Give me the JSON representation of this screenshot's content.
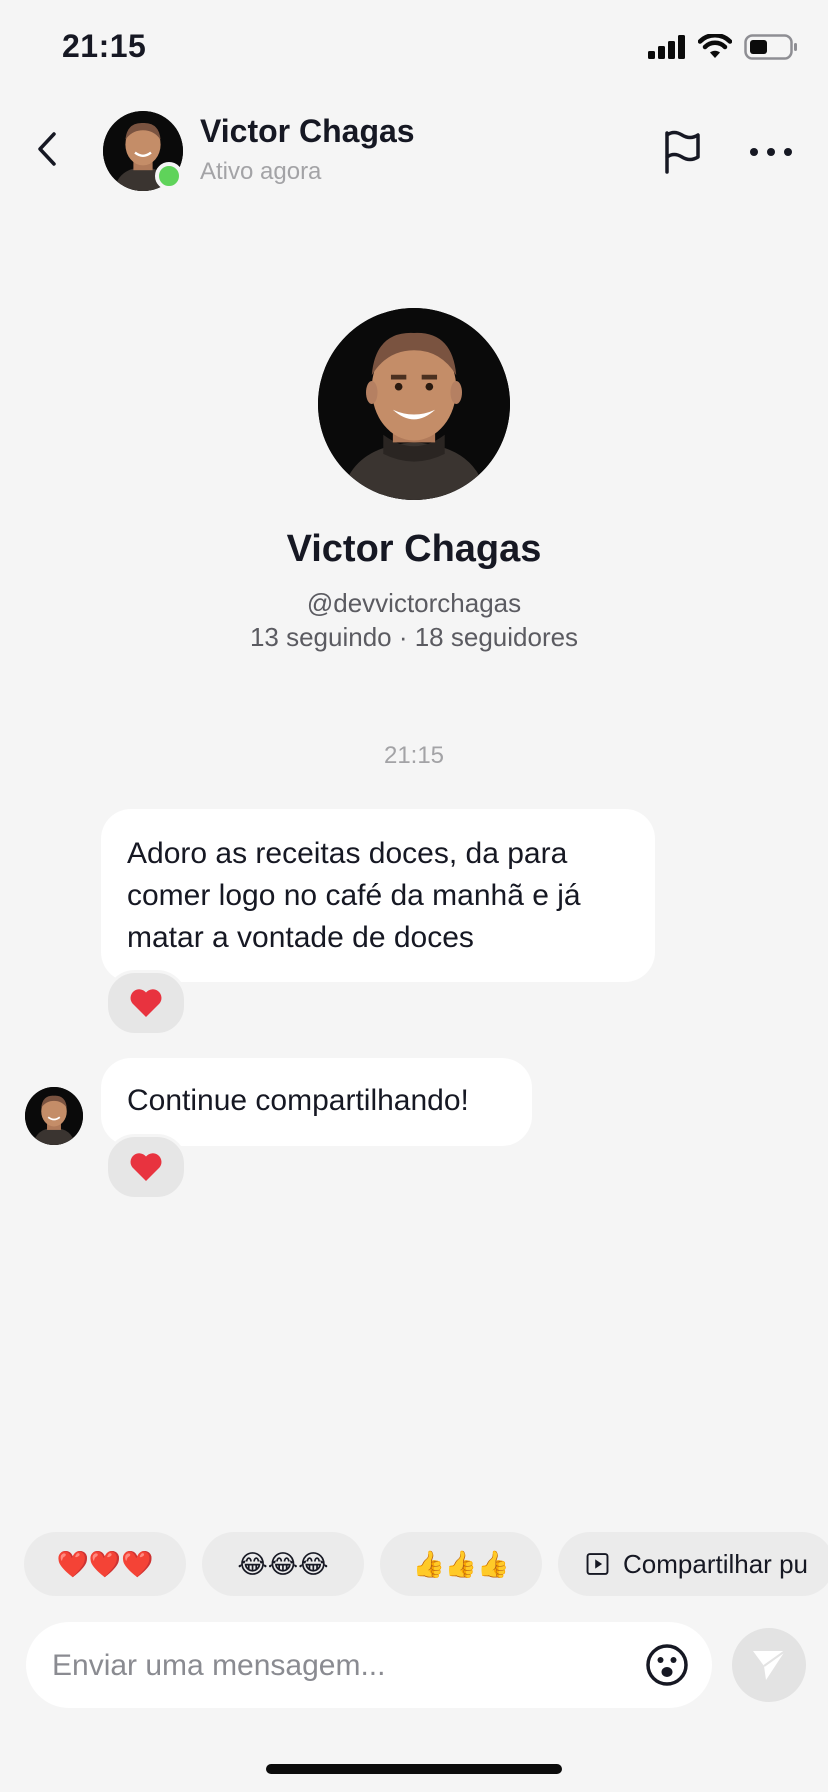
{
  "status_bar": {
    "time": "21:15"
  },
  "header": {
    "name": "Victor Chagas",
    "status": "Ativo agora",
    "icons": {
      "back": "chevron-left-icon",
      "report": "flag-icon",
      "more": "more-horizontal-icon"
    },
    "online_color": "#5fd35a"
  },
  "profile": {
    "name": "Victor Chagas",
    "handle": "@devvictorchagas",
    "stats": "13 seguindo · 18 seguidores"
  },
  "chat": {
    "timestamp": "21:15",
    "messages": [
      {
        "text": "Adoro as receitas doces, da para comer logo no café da manhã e já matar a vontade de doces",
        "reaction": "❤️"
      },
      {
        "text": "Continue compartilhando!",
        "reaction": "❤️"
      }
    ]
  },
  "quick_replies": [
    {
      "label": "❤️❤️❤️"
    },
    {
      "label": "😂😂😂"
    },
    {
      "label": "👍👍👍"
    },
    {
      "label": "Compartilhar pu",
      "icon": "play-square-icon"
    }
  ],
  "composer": {
    "placeholder": "Enviar uma mensagem...",
    "emoji_icon": "smiley-icon",
    "send_icon": "send-icon"
  }
}
